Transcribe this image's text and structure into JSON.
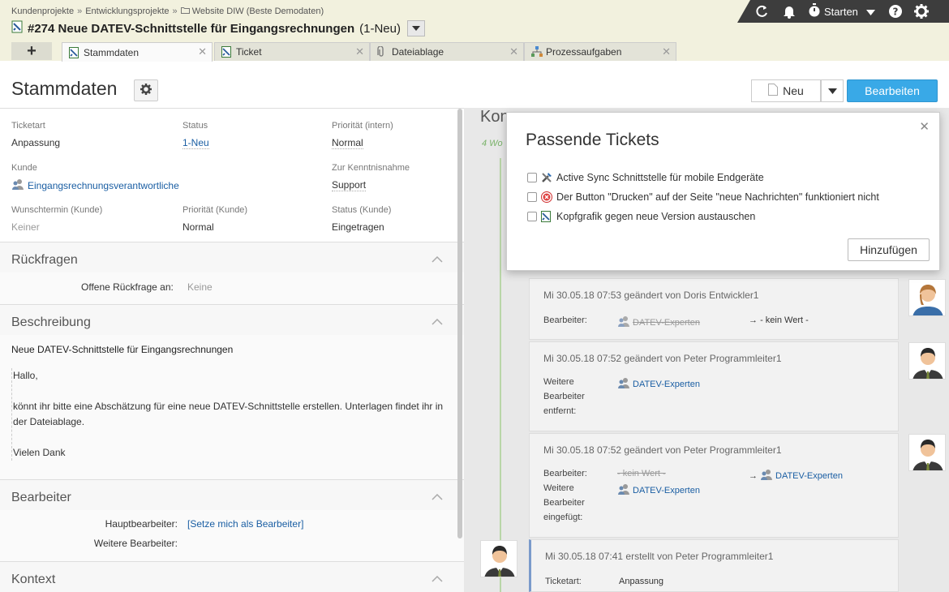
{
  "breadcrumb": [
    "Kundenprojekte",
    "Entwicklungsprojekte",
    "Website DIW (Beste Demodaten)"
  ],
  "ticket": {
    "number": "#274 Neue DATEV-Schnittstelle für Eingangsrechnungen",
    "state": "(1-Neu)"
  },
  "toolbar": {
    "start_label": "Starten"
  },
  "tabs": [
    {
      "label": "Stammdaten",
      "icon": "ticket-icon"
    },
    {
      "label": "Ticket",
      "icon": "ticket-icon"
    },
    {
      "label": "Dateiablage",
      "icon": "paperclip-icon"
    },
    {
      "label": "Prozessaufgaben",
      "icon": "process-icon"
    }
  ],
  "page": {
    "title": "Stammdaten",
    "new_label": "Neu",
    "edit_label": "Bearbeiten"
  },
  "fields": {
    "ticketart": {
      "label": "Ticketart",
      "value": "Anpassung"
    },
    "status": {
      "label": "Status",
      "value": "1-Neu"
    },
    "prio_intern": {
      "label": "Priorität (intern)",
      "value": "Normal"
    },
    "kunde": {
      "label": "Kunde",
      "value": "Eingangsrechnungsverantwortliche"
    },
    "kenntnis": {
      "label": "Zur Kenntnisnahme",
      "value": "Support"
    },
    "wunschtermin": {
      "label": "Wunschtermin (Kunde)",
      "value": "Keiner"
    },
    "prio_kunde": {
      "label": "Priorität (Kunde)",
      "value": "Normal"
    },
    "status_kunde": {
      "label": "Status (Kunde)",
      "value": "Eingetragen"
    }
  },
  "rueckfragen": {
    "title": "Rückfragen",
    "label": "Offene Rückfrage an:",
    "value": "Keine"
  },
  "beschreibung": {
    "title": "Beschreibung",
    "heading": "Neue DATEV-Schnittstelle für Eingangsrechnungen",
    "p1": "Hallo,",
    "p2": "könnt ihr bitte eine Abschätzung für eine neue DATEV-Schnittstelle erstellen. Unterlagen findet ihr in der Dateiablage.",
    "p3": "Vielen Dank"
  },
  "bearbeiter": {
    "title": "Bearbeiter",
    "haupt_label": "Hauptbearbeiter:",
    "haupt_value": "[Setze mich als Bearbeiter]",
    "weitere_label": "Weitere Bearbeiter:"
  },
  "kontext": {
    "title": "Kontext"
  },
  "timeline": {
    "title_visible": "Kon",
    "weeks_label": "4 Wo",
    "entries": [
      {
        "header": "Mi 30.05.18 07:53 geändert von Doris Entwickler1",
        "label": "Bearbeiter:",
        "old": "DATEV-Experten",
        "new": "- kein Wert -"
      },
      {
        "header": "Mi 30.05.18 07:52 geändert von Peter Programmleiter1",
        "label1": "Weitere",
        "label2": "Bearbeiter",
        "label3": "entfernt:",
        "value": "DATEV-Experten"
      },
      {
        "header": "Mi 30.05.18 07:52 geändert von Peter Programmleiter1",
        "label": "Bearbeiter:",
        "old": "- kein Wert -",
        "new": "DATEV-Experten",
        "label1": "Weitere",
        "label2": "Bearbeiter",
        "label3": "eingefügt:",
        "value": "DATEV-Experten"
      },
      {
        "header": "Mi 30.05.18 07:41 erstellt von Peter Programmleiter1",
        "label": "Ticketart:",
        "value": "Anpassung"
      }
    ]
  },
  "modal": {
    "title": "Passende Tickets",
    "items": [
      "Active Sync Schnittstelle für mobile Endgeräte",
      "Der Button \"Drucken\" auf der Seite \"neue Nachrichten\" funktioniert nicht",
      "Kopfgrafik gegen neue Version austauschen"
    ],
    "add_label": "Hinzufügen"
  },
  "colors": {
    "accent": "#39a9e7",
    "topbar": "#f2f1de",
    "toolbar": "#3d3d3d",
    "link": "#1a5ea3"
  }
}
